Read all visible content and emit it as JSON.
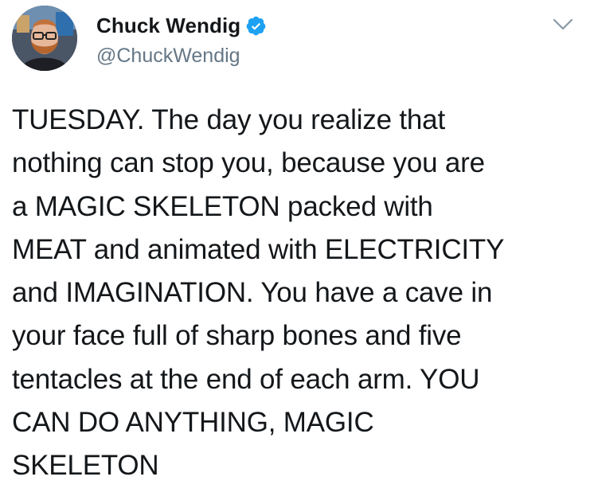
{
  "author": {
    "display_name": "Chuck Wendig",
    "handle": "@ChuckWendig",
    "verified": true
  },
  "tweet": {
    "lines": [
      "TUESDAY. The day you realize that",
      "nothing can stop you, because you are",
      "a MAGIC SKELETON packed with",
      "MEAT and animated with ELECTRICITY",
      "and IMAGINATION. You have a cave in",
      "your face full of sharp bones and five",
      "tentacles at the end of each arm. YOU",
      "CAN DO ANYTHING, MAGIC",
      "SKELETON"
    ]
  },
  "icons": {
    "verified": "verified-badge-icon",
    "menu": "chevron-down-icon"
  },
  "colors": {
    "verified_blue": "#1da1f2",
    "handle_gray": "#657786",
    "text": "#14171a",
    "caret_gray": "#8899a6"
  }
}
